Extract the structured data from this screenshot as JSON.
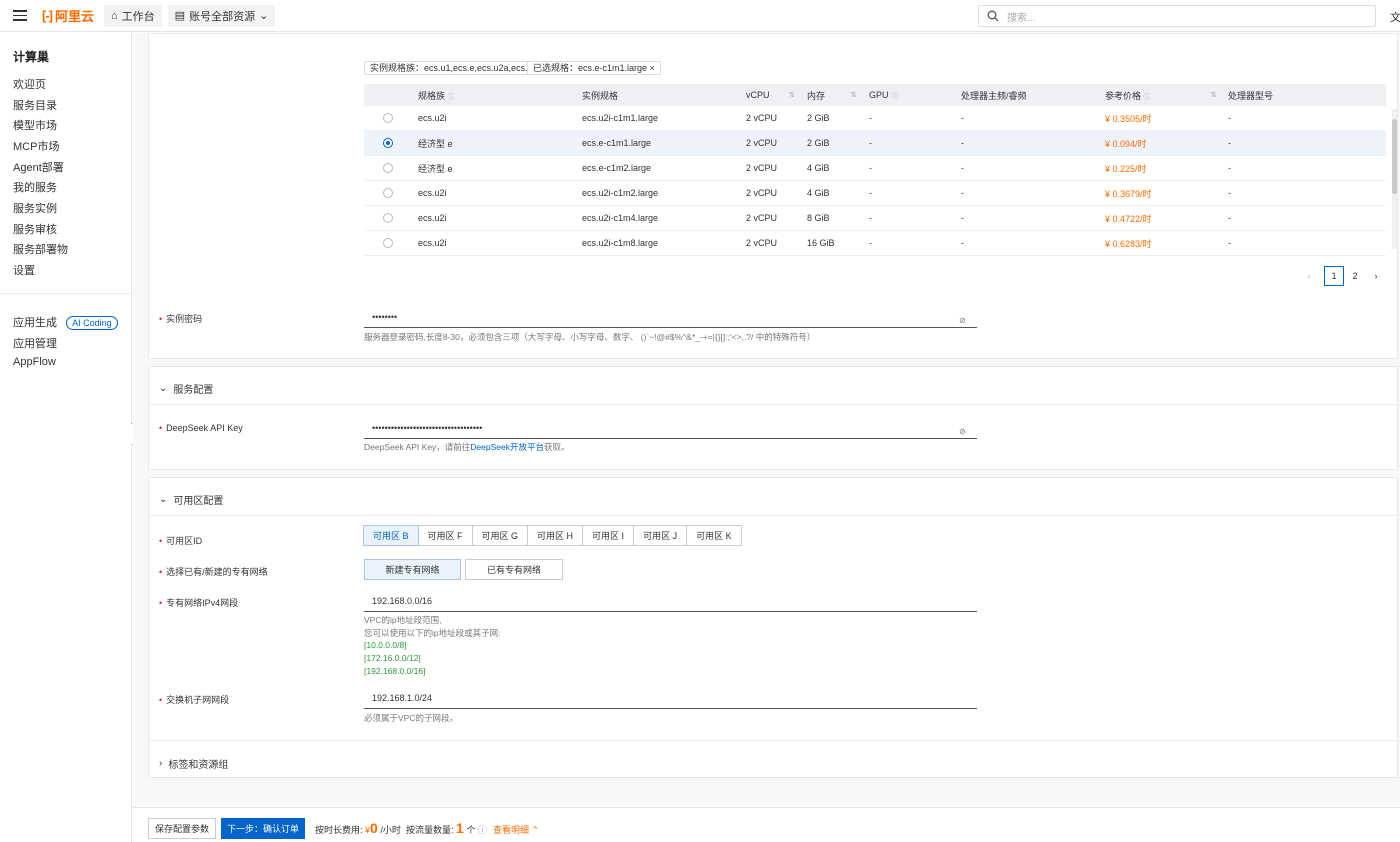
{
  "topbar": {
    "logo_text": "阿里云",
    "workbench": "工作台",
    "account_resources": "账号全部资源",
    "search_placeholder": "搜索...",
    "right_text": "文档"
  },
  "sidebar": {
    "title": "计算巢",
    "items": [
      "欢迎页",
      "服务目录",
      "模型市场",
      "MCP市场",
      "Agent部署",
      "我的服务",
      "服务实例",
      "服务审核",
      "服务部署物",
      "设置"
    ],
    "items2": [
      "应用生成",
      "应用管理",
      "AppFlow"
    ],
    "ai_badge": "AI Coding"
  },
  "filters": {
    "family_tag": "实例规格族：ecs.u1,ecs.e,ecs.u2a,ecs.u2i",
    "selected_tag": "已选规格：ecs.e-c1m1.large ×"
  },
  "table": {
    "headers": [
      "规格族",
      "实例规格",
      "vCPU",
      "内存",
      "GPU",
      "处理器主频/睿频",
      "参考价格",
      "处理器型号"
    ],
    "rows": [
      {
        "family": "ecs.u2i",
        "spec": "ecs.u2i-c1m1.large",
        "vcpu": "2 vCPU",
        "mem": "2 GiB",
        "gpu": "-",
        "freq": "-",
        "price": "¥ 0.3505/时",
        "model": "-",
        "selected": false
      },
      {
        "family": "经济型 e",
        "spec": "ecs.e-c1m1.large",
        "vcpu": "2 vCPU",
        "mem": "2 GiB",
        "gpu": "-",
        "freq": "-",
        "price": "¥ 0.094/时",
        "model": "-",
        "selected": true
      },
      {
        "family": "经济型 e",
        "spec": "ecs.e-c1m2.large",
        "vcpu": "2 vCPU",
        "mem": "4 GiB",
        "gpu": "-",
        "freq": "-",
        "price": "¥ 0.225/时",
        "model": "-",
        "selected": false
      },
      {
        "family": "ecs.u2i",
        "spec": "ecs.u2i-c1m2.large",
        "vcpu": "2 vCPU",
        "mem": "4 GiB",
        "gpu": "-",
        "freq": "-",
        "price": "¥ 0.3679/时",
        "model": "-",
        "selected": false
      },
      {
        "family": "ecs.u2i",
        "spec": "ecs.u2i-c1m4.large",
        "vcpu": "2 vCPU",
        "mem": "8 GiB",
        "gpu": "-",
        "freq": "-",
        "price": "¥ 0.4722/时",
        "model": "-",
        "selected": false
      },
      {
        "family": "ecs.u2i",
        "spec": "ecs.u2i-c1m8.large",
        "vcpu": "2 vCPU",
        "mem": "16 GiB",
        "gpu": "-",
        "freq": "-",
        "price": "¥ 0.6283/时",
        "model": "-",
        "selected": false
      }
    ]
  },
  "pagination": {
    "pages": [
      "1",
      "2"
    ],
    "current": "1"
  },
  "instance_password": {
    "label": "实例密码",
    "value": "••••••••",
    "help": "服务器登录密码,长度8-30，必须包含三项（大写字母、小写字母、数字、 ()`~!@#$%^&*_-+=|{}[]:;'<>,.?/ 中的特殊符号）"
  },
  "service_config": {
    "title": "服务配置",
    "api_key_label": "DeepSeek API Key",
    "api_key_value": "•••••••••••••••••••••••••••••••••••",
    "help_prefix": "DeepSeek API Key，请前往",
    "help_link": "DeepSeek开放平台",
    "help_suffix": "获取。"
  },
  "zone_config": {
    "title": "可用区配置",
    "zone_label": "可用区ID",
    "zones": [
      "可用区 B",
      "可用区 F",
      "可用区 G",
      "可用区 H",
      "可用区 I",
      "可用区 J",
      "可用区 K"
    ],
    "selected_zone": "可用区 B",
    "vpc_label": "选择已有/新建的专有网络",
    "vpc_new": "新建专有网络",
    "vpc_existing": "已有专有网络",
    "cidr_label": "专有网络IPv4网段",
    "cidr_value": "192.168.0.0/16",
    "cidr_help1": "VPC的ip地址段范围,",
    "cidr_help2": "您可以使用以下的ip地址段或其子网:",
    "cidr_options": [
      "[10.0.0.0/8]",
      "[172.16.0.0/12]",
      "[192.168.0.0/16]"
    ],
    "vswitch_label": "交换机子网网段",
    "vswitch_value": "192.168.1.0/24",
    "vswitch_help": "必须属于VPC的子网段。"
  },
  "tags_section": {
    "title": "标签和资源组"
  },
  "footer": {
    "save_btn": "保存配置参数",
    "next_btn": "下一步：确认订单",
    "hourly_label": "按时长费用:",
    "hourly_currency": "¥",
    "hourly_value": "0",
    "hourly_unit": "/小时",
    "traffic_label": "按流量数量:",
    "traffic_value": "1",
    "traffic_unit": "个",
    "details_link": "查看明细"
  }
}
